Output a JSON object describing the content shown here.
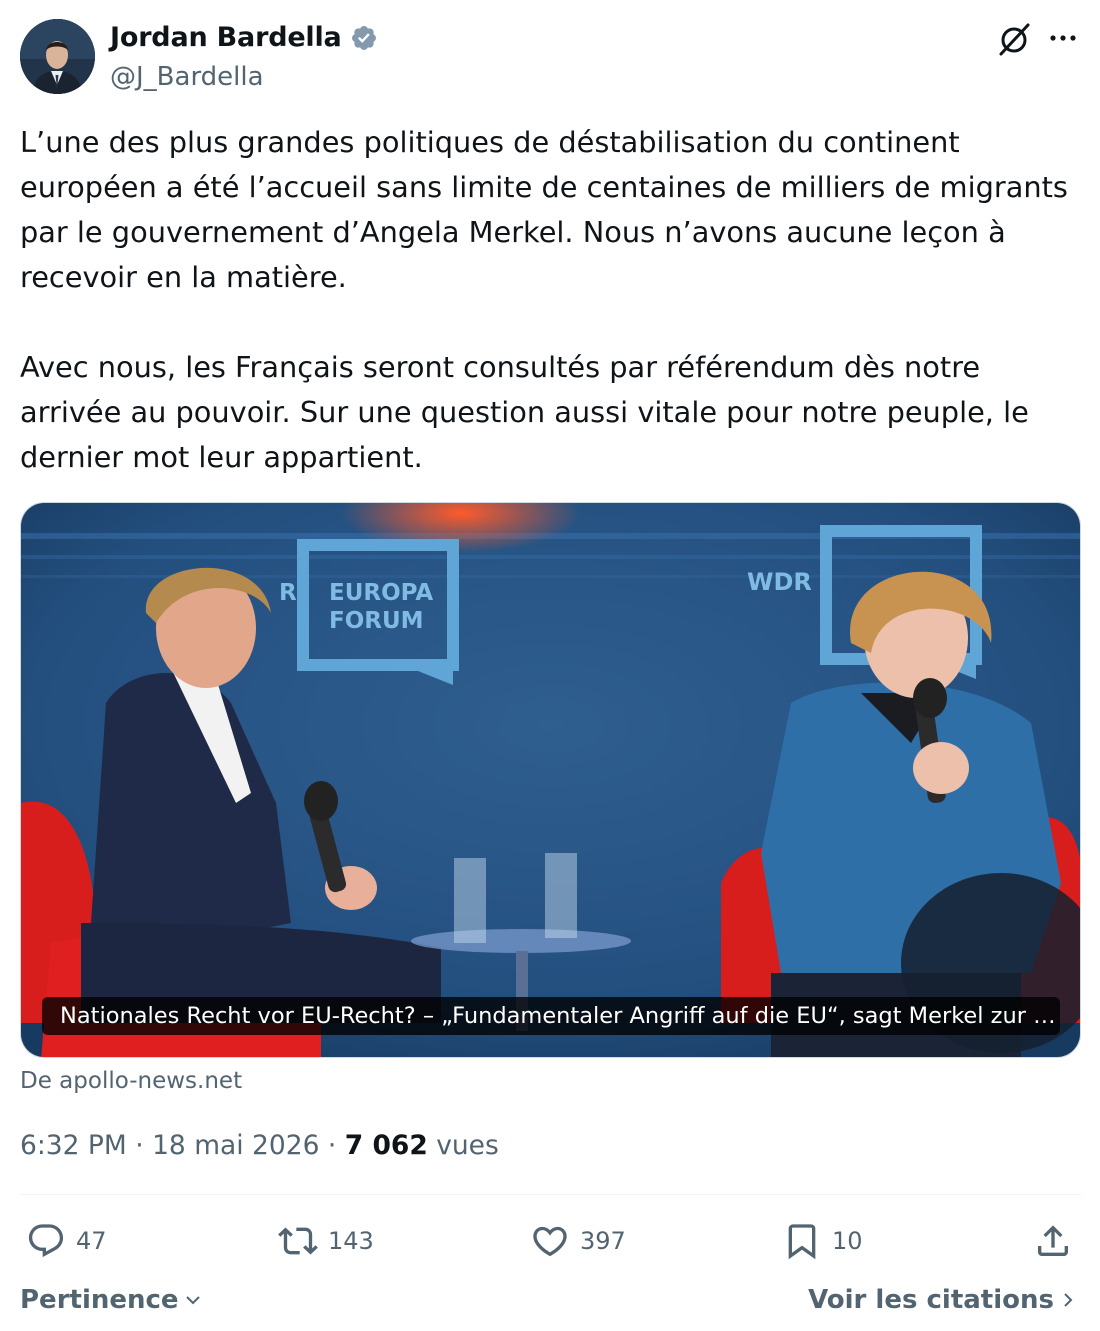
{
  "author": {
    "name": "Jordan Bardella",
    "handle": "@J_Bardella"
  },
  "tweet": {
    "paragraphs": [
      "L’une des plus grandes politiques de déstabilisation du continent européen a été l’accueil sans limite de centaines de milliers de migrants par le gouvernement d’Angela Merkel. Nous n’avons aucune leçon à recevoir en la matière.",
      "Avec nous, les Français seront consultés par référendum dès notre arrivée au pouvoir. Sur une question aussi vitale pour notre peuple, le dernier mot leur appartient."
    ]
  },
  "card": {
    "caption": "Nationales Recht vor EU-Recht? – „Fundamentaler Angriff auf die EU“, sagt Merkel zur …",
    "sign_left_line1": "EUROPA",
    "sign_left_line2": "FORUM",
    "sign_left_partial": "R",
    "sign_right_partial": "WDR"
  },
  "source": "De apollo-news.net",
  "meta": {
    "time": "6:32 PM",
    "date": "18 mai 2026",
    "separator": " · ",
    "views_count": "7 062",
    "views_label": "vues"
  },
  "actions": {
    "replies": "47",
    "reposts": "143",
    "likes": "397",
    "bookmarks": "10"
  },
  "footer": {
    "sort_label": "Pertinence",
    "quotes_label": "Voir les citations"
  },
  "colors": {
    "text": "#0f1419",
    "secondary": "#536471",
    "verified": "#829aab",
    "divider": "#eff3f4"
  },
  "icons": [
    "verified-badge-icon",
    "grok-icon",
    "more-icon",
    "reply-icon",
    "repost-icon",
    "like-icon",
    "bookmark-icon",
    "share-icon",
    "chevron-down-icon",
    "chevron-right-icon"
  ]
}
